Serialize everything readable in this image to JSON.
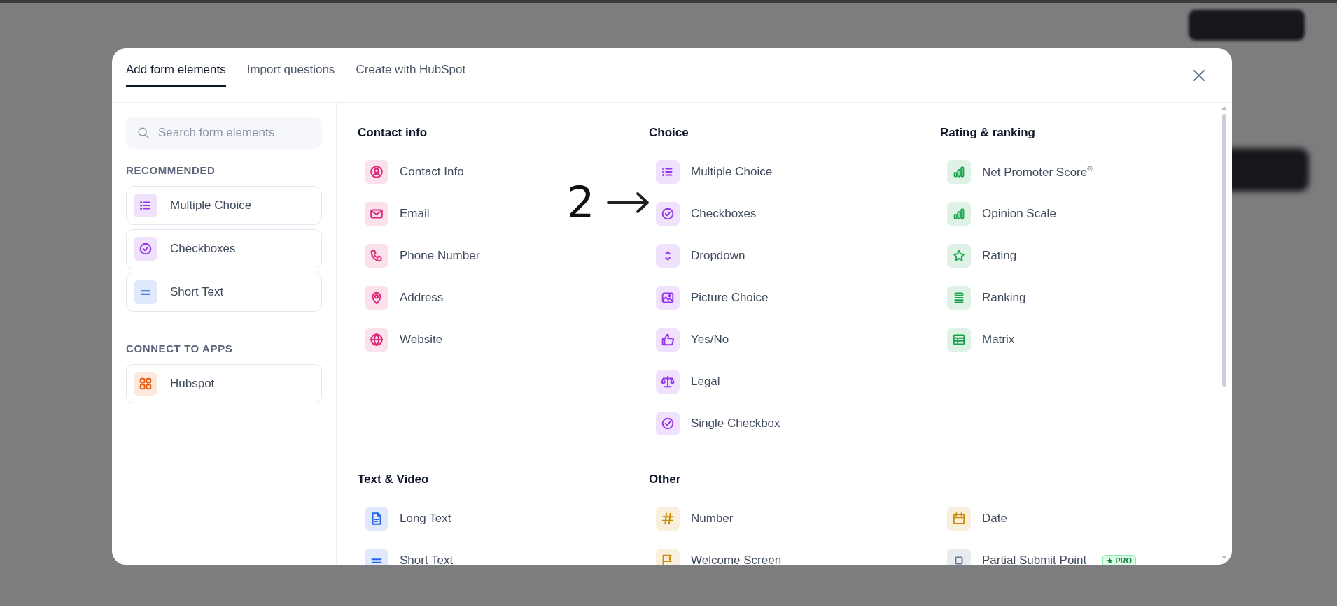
{
  "tabs": [
    {
      "label": "Add form elements",
      "selected": true
    },
    {
      "label": "Import questions",
      "selected": false
    },
    {
      "label": "Create with HubSpot",
      "selected": false
    }
  ],
  "sidebar": {
    "search": {
      "placeholder": "Search form elements"
    },
    "groups": [
      {
        "title": "RECOMMENDED",
        "items": [
          {
            "label": "Multiple Choice",
            "kind": "list",
            "color": "#9333ea"
          },
          {
            "label": "Checkboxes",
            "kind": "check",
            "color": "#9333ea"
          },
          {
            "label": "Short Text",
            "kind": "lines",
            "color": "#2563eb"
          }
        ]
      },
      {
        "title": "CONNECT TO APPS",
        "items": [
          {
            "label": "Hubspot",
            "kind": "apps",
            "color": "#ea580c"
          }
        ]
      }
    ]
  },
  "sections": [
    {
      "title": "Contact info",
      "items": [
        {
          "label": "Contact Info",
          "kind": "user",
          "color": "#db2777"
        },
        {
          "label": "Email",
          "kind": "mail",
          "color": "#db2777"
        },
        {
          "label": "Phone Number",
          "kind": "phone",
          "color": "#db2777"
        },
        {
          "label": "Address",
          "kind": "pin",
          "color": "#db2777"
        },
        {
          "label": "Website",
          "kind": "globe",
          "color": "#db2777"
        }
      ]
    },
    {
      "title": "Choice",
      "items": [
        {
          "label": "Multiple Choice",
          "kind": "list",
          "color": "#9333ea"
        },
        {
          "label": "Checkboxes",
          "kind": "check",
          "color": "#9333ea"
        },
        {
          "label": "Dropdown",
          "kind": "updown",
          "color": "#9333ea"
        },
        {
          "label": "Picture Choice",
          "kind": "image",
          "color": "#9333ea"
        },
        {
          "label": "Yes/No",
          "kind": "thumb",
          "color": "#9333ea"
        },
        {
          "label": "Legal",
          "kind": "scale",
          "color": "#9333ea"
        },
        {
          "label": "Single Checkbox",
          "kind": "check",
          "color": "#9333ea"
        }
      ]
    },
    {
      "title": "Rating & ranking",
      "items": [
        {
          "label": "Net Promoter Score",
          "sup": "®",
          "kind": "bars",
          "color": "#16a34a"
        },
        {
          "label": "Opinion Scale",
          "kind": "bars",
          "color": "#16a34a"
        },
        {
          "label": "Rating",
          "kind": "star",
          "color": "#16a34a"
        },
        {
          "label": "Ranking",
          "kind": "stack",
          "color": "#16a34a"
        },
        {
          "label": "Matrix",
          "kind": "table",
          "color": "#16a34a"
        }
      ]
    },
    {
      "title": "Text & Video",
      "items": [
        {
          "label": "Long Text",
          "kind": "doc",
          "color": "#2563eb"
        },
        {
          "label": "Short Text",
          "kind": "lines",
          "color": "#2563eb"
        }
      ]
    },
    {
      "title": "Other",
      "columns": [
        [
          {
            "label": "Number",
            "kind": "hash",
            "color": "#ca8a04"
          },
          {
            "label": "Welcome Screen",
            "kind": "flag",
            "color": "#ca8a04"
          }
        ],
        [
          {
            "label": "Date",
            "kind": "calendar",
            "color": "#ca8a04"
          },
          {
            "label": "Partial Submit Point",
            "kind": "square",
            "color": "#64748b",
            "badge": "PRO"
          }
        ]
      ]
    }
  ],
  "annotation": {
    "label": "2"
  }
}
